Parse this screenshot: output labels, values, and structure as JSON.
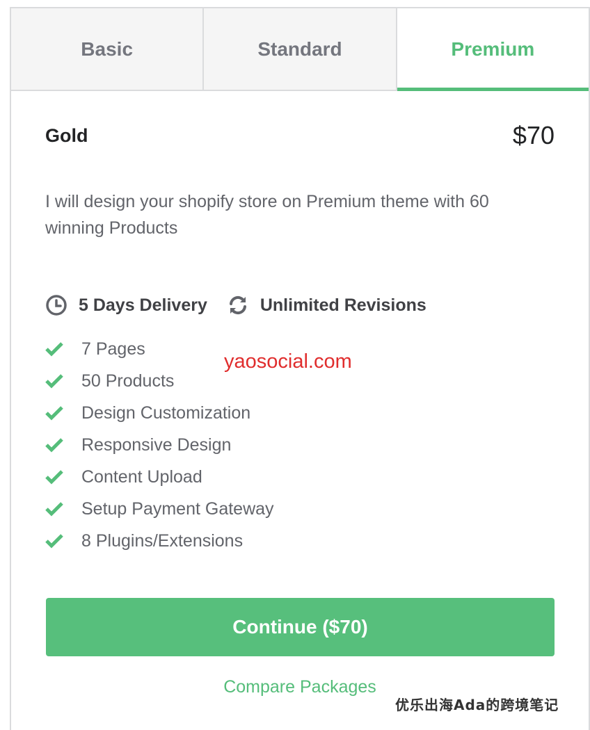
{
  "tabs": [
    {
      "label": "Basic",
      "active": false
    },
    {
      "label": "Standard",
      "active": false
    },
    {
      "label": "Premium",
      "active": true
    }
  ],
  "package": {
    "name": "Gold",
    "price": "$70",
    "description": "I will design your shopify store on Premium theme with 60 winning Products",
    "delivery": "5 Days Delivery",
    "revisions": "Unlimited Revisions",
    "features": [
      "7 Pages",
      "50 Products",
      "Design Customization",
      "Responsive Design",
      "Content Upload",
      "Setup Payment Gateway",
      "8 Plugins/Extensions"
    ]
  },
  "actions": {
    "continue_label": "Continue ($70)",
    "compare_label": "Compare Packages"
  },
  "watermarks": {
    "site": "yaosocial.com",
    "author": "优乐出海Ada的跨境笔记"
  },
  "colors": {
    "accent": "#55bd7a",
    "button": "#57bf7c",
    "watermark_red": "#e02d2d"
  }
}
